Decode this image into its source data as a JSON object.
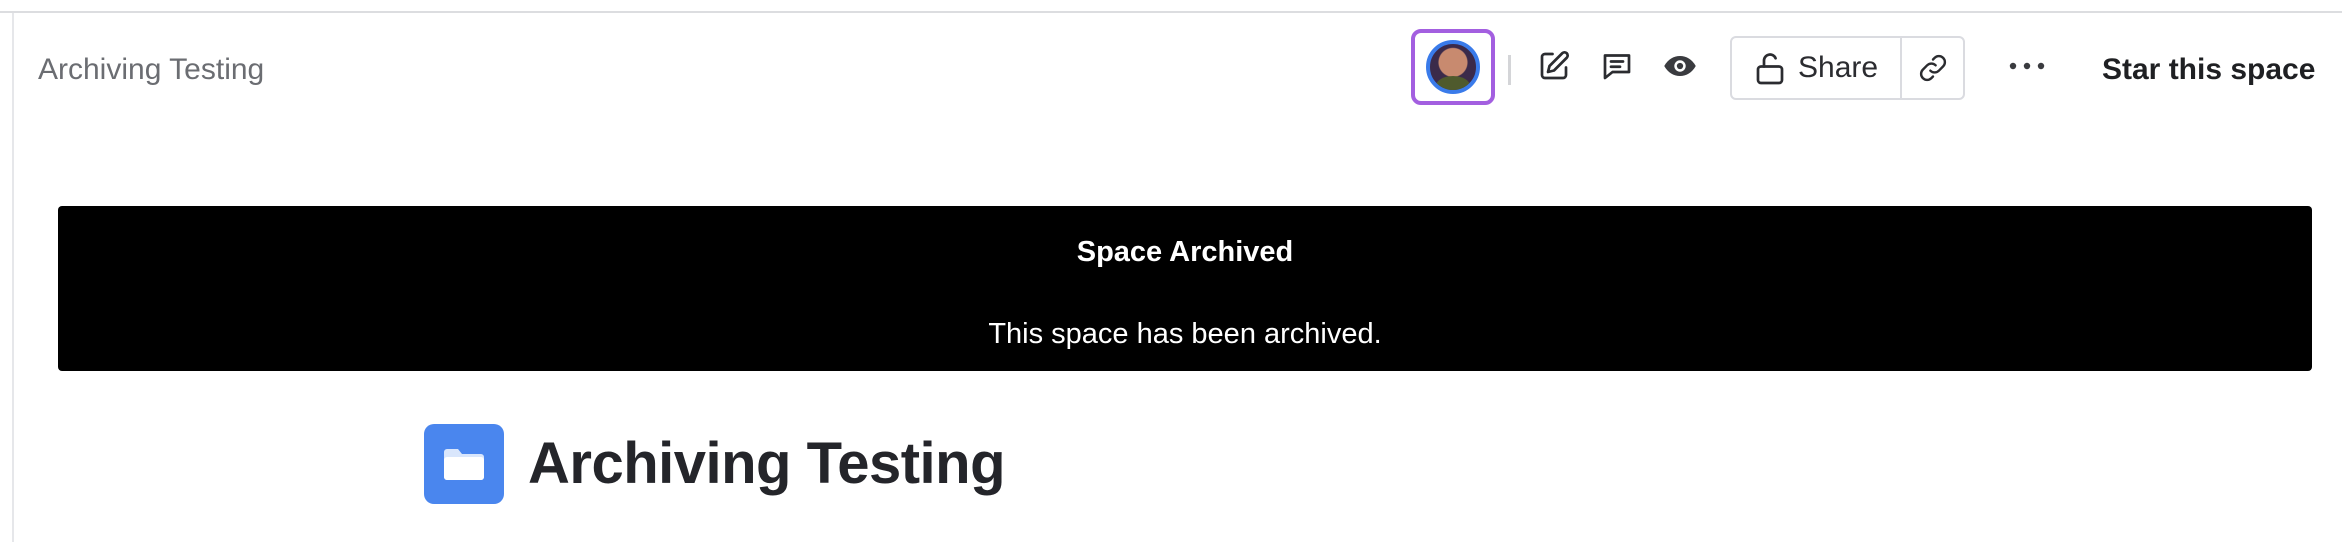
{
  "header": {
    "breadcrumb": "Archiving Testing",
    "share_label": "Share",
    "star_label": "Star this space"
  },
  "banner": {
    "title": "Space Archived",
    "message": "This space has been archived."
  },
  "space": {
    "title": "Archiving Testing"
  },
  "icons": {
    "avatar": "user-avatar",
    "edit": "pencil-edit-icon",
    "comments": "comment-icon",
    "watch": "eye-icon",
    "share": "unlock-icon",
    "copy_link": "link-icon",
    "more": "more-horizontal-icon",
    "space": "folder-icon"
  },
  "colors": {
    "avatar_highlight": "#a35fe0",
    "banner_background": "#000000",
    "space_icon": "#4a86ee"
  }
}
